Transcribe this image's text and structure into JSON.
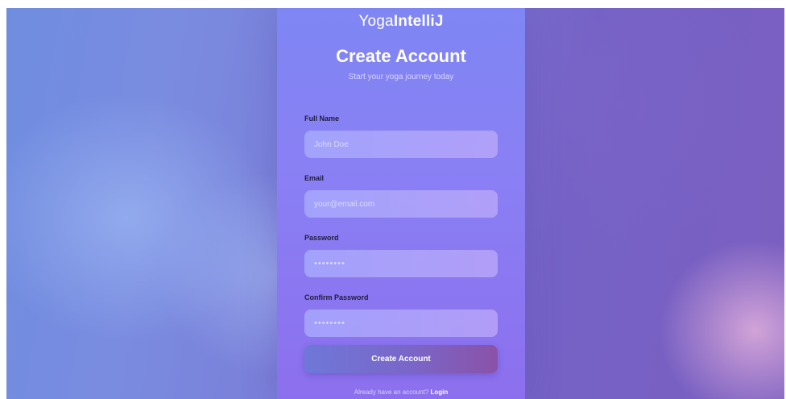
{
  "brand": {
    "name_part1": "Yoga",
    "name_part2": "IntelliJ"
  },
  "header": {
    "title": "Create Account",
    "subtitle": "Start your yoga journey today"
  },
  "form": {
    "full_name": {
      "label": "Full Name",
      "placeholder": "John Doe",
      "value": ""
    },
    "email": {
      "label": "Email",
      "placeholder": "your@email.com",
      "value": ""
    },
    "password": {
      "label": "Password",
      "placeholder": "••••••••",
      "value": ""
    },
    "confirm_password": {
      "label": "Confirm Password",
      "placeholder": "••••••••",
      "value": ""
    },
    "submit_label": "Create Account"
  },
  "footer": {
    "prompt": "Already have an account?",
    "login_label": "Login"
  },
  "colors": {
    "card_top": "#7f86f4",
    "card_bottom": "#8c6fee",
    "button_start": "#6e78d8",
    "button_end": "#8a52a8"
  }
}
